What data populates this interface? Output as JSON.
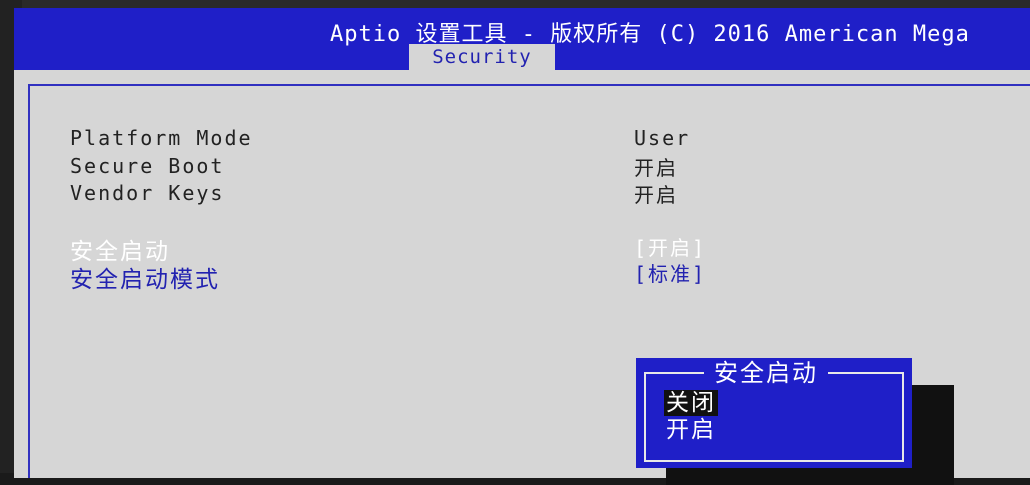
{
  "header": {
    "title": "Aptio 设置工具 - 版权所有 (C) 2016 American Mega",
    "tab": "Security"
  },
  "info_rows": [
    {
      "label": "Platform Mode",
      "value": "User"
    },
    {
      "label": "Secure Boot",
      "value": "开启"
    },
    {
      "label": "Vendor Keys",
      "value": "开启"
    }
  ],
  "settings": [
    {
      "label": "安全启动",
      "value": "[开启]"
    },
    {
      "label": "安全启动模式",
      "value": "[标准]"
    }
  ],
  "popup": {
    "title": "安全启动",
    "options": [
      "关闭",
      "开启"
    ],
    "selected": "关闭"
  },
  "colors": {
    "header_bg": "#1f1fc8",
    "screen_bg": "#d6d6d6",
    "highlight_text": "#ffffff",
    "option_text": "#2222b0"
  }
}
